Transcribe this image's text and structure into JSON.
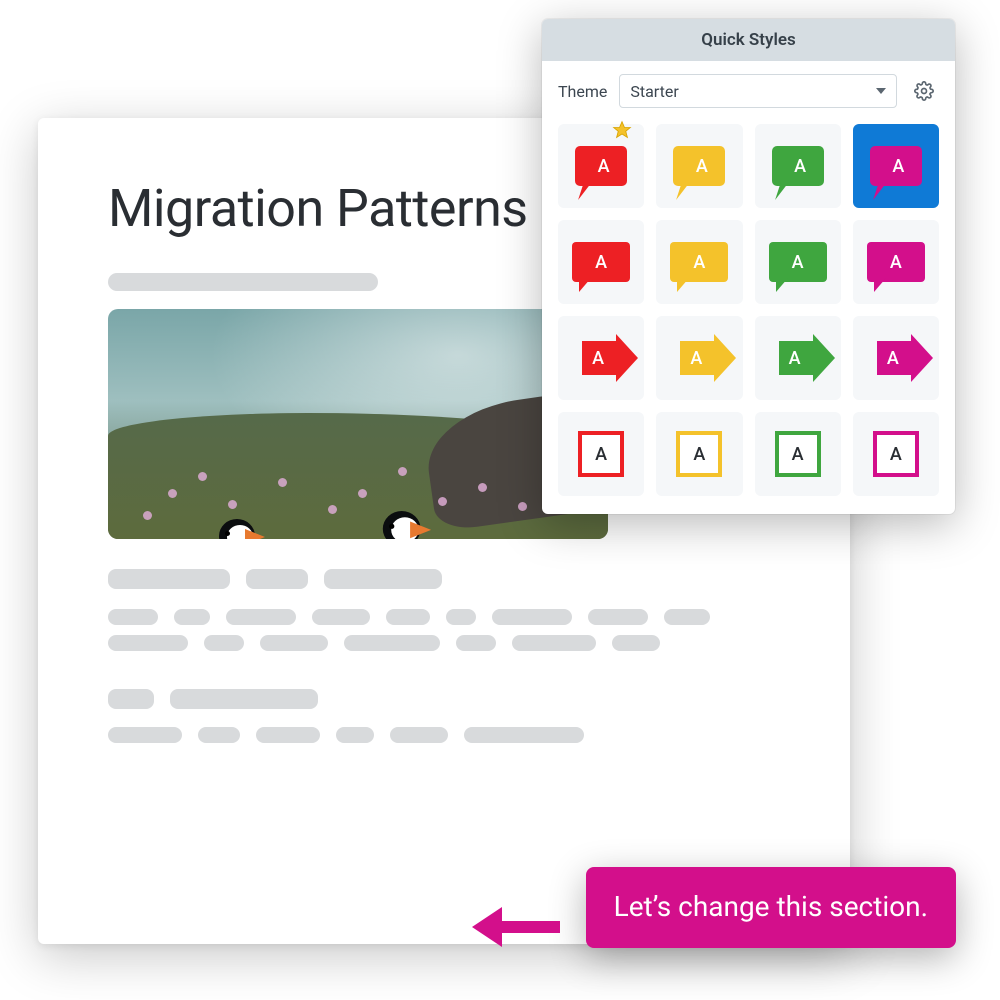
{
  "document": {
    "title": "Migration Patterns"
  },
  "panel": {
    "title": "Quick Styles",
    "theme_label": "Theme",
    "theme_value": "Starter"
  },
  "colors": {
    "red": "#ed2024",
    "yellow": "#f4c22b",
    "green": "#3fa63f",
    "magenta": "#d30f8b",
    "blue": "#0f7ad6"
  },
  "swatch_letter": "A",
  "style_rows": [
    {
      "shape": "callout",
      "starred_index": 0,
      "items": [
        {
          "color": "red"
        },
        {
          "color": "yellow"
        },
        {
          "color": "green"
        },
        {
          "color": "magenta",
          "selected": true
        }
      ]
    },
    {
      "shape": "speech",
      "items": [
        {
          "color": "red"
        },
        {
          "color": "yellow"
        },
        {
          "color": "green"
        },
        {
          "color": "magenta"
        }
      ]
    },
    {
      "shape": "arrow",
      "items": [
        {
          "color": "red"
        },
        {
          "color": "yellow"
        },
        {
          "color": "green"
        },
        {
          "color": "magenta"
        }
      ]
    },
    {
      "shape": "box-outline",
      "items": [
        {
          "color": "red"
        },
        {
          "color": "yellow"
        },
        {
          "color": "green"
        },
        {
          "color": "magenta"
        }
      ]
    }
  ],
  "annotation": {
    "text": "Let’s change this section."
  }
}
